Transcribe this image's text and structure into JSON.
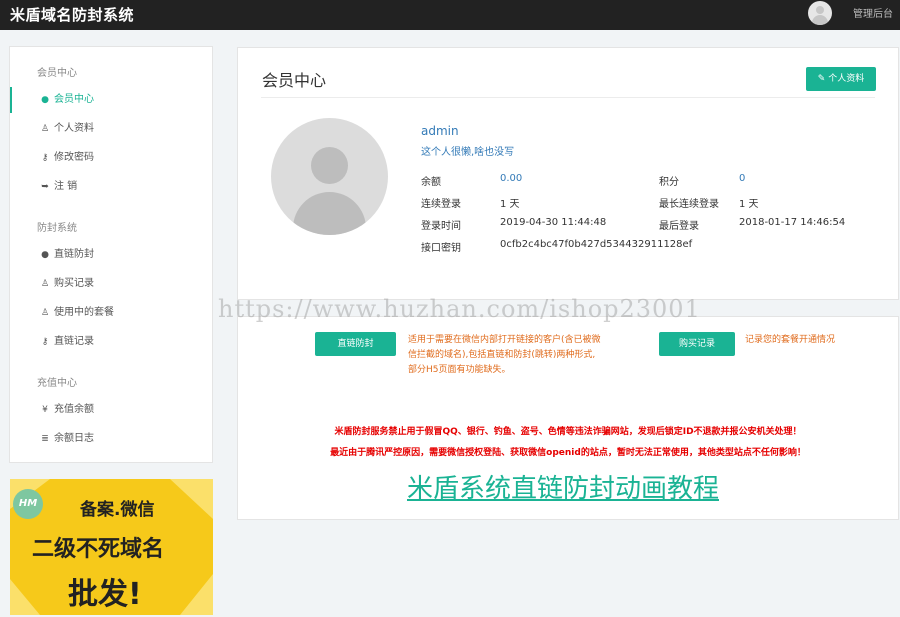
{
  "header": {
    "brand": "米盾域名防封系统",
    "admin_link": "管理后台"
  },
  "sidebar": {
    "sections": [
      {
        "title": "会员中心",
        "items": [
          {
            "label": "会员中心",
            "icon": "user-circle-icon",
            "glyph": "●"
          },
          {
            "label": "个人资料",
            "icon": "user-icon",
            "glyph": "♙"
          },
          {
            "label": "修改密码",
            "icon": "key-icon",
            "glyph": "⚷"
          },
          {
            "label": "注 销",
            "icon": "sign-out-icon",
            "glyph": "➥"
          }
        ]
      },
      {
        "title": "防封系统",
        "items": [
          {
            "label": "直链防封",
            "icon": "user-circle-icon",
            "glyph": "●"
          },
          {
            "label": "购买记录",
            "icon": "user-icon",
            "glyph": "♙"
          },
          {
            "label": "使用中的套餐",
            "icon": "user-icon",
            "glyph": "♙"
          },
          {
            "label": "直链记录",
            "icon": "key-icon",
            "glyph": "⚷"
          }
        ]
      },
      {
        "title": "充值中心",
        "items": [
          {
            "label": "充值余额",
            "icon": "yen-icon",
            "glyph": "¥"
          },
          {
            "label": "余额日志",
            "icon": "list-icon",
            "glyph": "≣"
          }
        ]
      }
    ]
  },
  "ad": {
    "badge": "HM",
    "line1": "备案.微信",
    "line2": "二级不死域名",
    "line3": "批发!"
  },
  "profile": {
    "title": "会员中心",
    "edit_button": "个人资料",
    "username": "admin",
    "signature": "这个人很懒,啥也没写",
    "fields": {
      "balance_label": "余额",
      "balance": "0.00",
      "points_label": "积分",
      "points": "0",
      "streak_label": "连续登录",
      "streak": "1 天",
      "max_streak_label": "最长连续登录",
      "max_streak": "1 天",
      "login_time_label": "登录时间",
      "login_time": "2019-04-30 11:44:48",
      "last_login_label": "最后登录",
      "last_login": "2018-01-17 14:46:54",
      "api_key_label": "接口密钥",
      "api_key": "0cfb2c4bc47f0b427d534432911128ef"
    }
  },
  "watermark": "https://www.huzhan.com/ishop23001",
  "services": {
    "direct_button": "直链防封",
    "direct_desc": [
      "适用于需要在微信内部打开链接的客户(含已被微",
      "信拦截的域名),包括直链和防封(跳转)两种形式,",
      "部分H5页面有功能缺失。"
    ],
    "purchase_button": "购买记录",
    "purchase_desc": "记录您的套餐开通情况",
    "warning1": "米盾防封服务禁止用于假冒QQ、银行、钓鱼、盗号、色情等违法诈骗网站，发现后锁定ID不退款并报公安机关处理！",
    "warning2": "最近由于腾讯严控原因，需要微信授权登陆、获取微信openid的站点，暂时无法正常使用，其他类型站点不任何影响！",
    "tutorial_link": "米盾系统直链防封动画教程"
  },
  "colors": {
    "accent": "#1ab394",
    "link": "#337ab7",
    "warning": "#e60000",
    "note": "#e06c1e",
    "topbar": "#222222"
  }
}
